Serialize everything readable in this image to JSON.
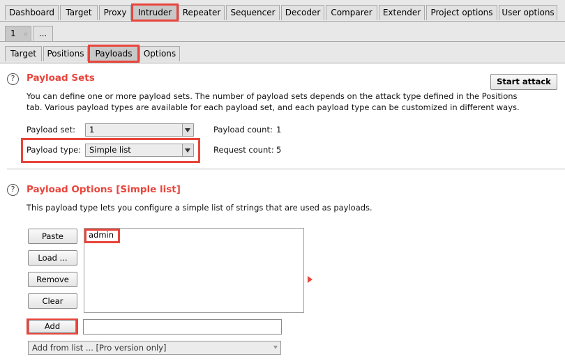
{
  "main_tabs": [
    "Dashboard",
    "Target",
    "Proxy",
    "Intruder",
    "Repeater",
    "Sequencer",
    "Decoder",
    "Comparer",
    "Extender",
    "Project options",
    "User options"
  ],
  "attack_tabs": {
    "tab1": "1",
    "tab1_close": "×",
    "more": "..."
  },
  "sub_tabs": [
    "Target",
    "Positions",
    "Payloads",
    "Options"
  ],
  "payload_sets": {
    "title": "Payload Sets",
    "description_line1": "You can define one or more payload sets. The number of payload sets depends on the attack type defined in the Positions",
    "description_line2": "tab. Various payload types are available for each payload set, and each payload type can be customized in different ways.",
    "start_attack": "Start attack",
    "payload_set_label": "Payload set:",
    "payload_set_value": "1",
    "payload_type_label": "Payload type:",
    "payload_type_value": "Simple list",
    "payload_count_label": "Payload count:",
    "payload_count_value": "1",
    "request_count_label": "Request count:",
    "request_count_value": "5"
  },
  "payload_options": {
    "title": "Payload Options [Simple list]",
    "description": "This payload type lets you configure a simple list of strings that are used as payloads.",
    "buttons": {
      "paste": "Paste",
      "load": "Load ...",
      "remove": "Remove",
      "clear": "Clear",
      "add": "Add"
    },
    "list_items": [
      "admin"
    ],
    "add_input_value": "",
    "add_from_list": "Add from list ... [Pro version only]"
  },
  "colors": {
    "accent": "#e8453c",
    "highlight": "#e8453c"
  }
}
